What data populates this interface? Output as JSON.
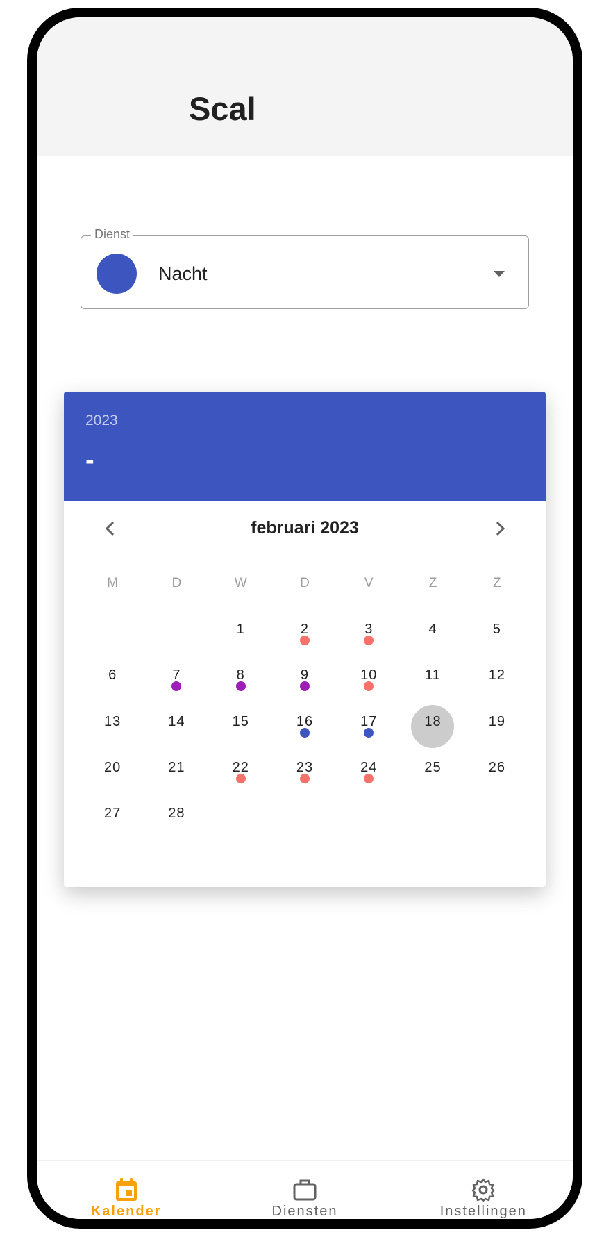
{
  "app": {
    "title": "Scal"
  },
  "dienst": {
    "label": "Dienst",
    "value": "Nacht",
    "color": "#3d55bf"
  },
  "calendar": {
    "header_color": "#3d55bf",
    "year": "2023",
    "selected_label": "-",
    "month_label": "februari 2023",
    "weekdays": [
      "M",
      "D",
      "W",
      "D",
      "V",
      "Z",
      "Z"
    ],
    "colors": {
      "salmon": "#f4726a",
      "purple": "#9c1fb5",
      "blue": "#3d55bf",
      "today": "#cccccc"
    },
    "weeks": [
      [
        null,
        null,
        {
          "d": "1"
        },
        {
          "d": "2",
          "dot": "salmon"
        },
        {
          "d": "3",
          "dot": "salmon"
        },
        {
          "d": "4"
        },
        {
          "d": "5"
        }
      ],
      [
        {
          "d": "6"
        },
        {
          "d": "7",
          "dot": "purple"
        },
        {
          "d": "8",
          "dot": "purple"
        },
        {
          "d": "9",
          "dot": "purple"
        },
        {
          "d": "10",
          "dot": "salmon"
        },
        {
          "d": "11"
        },
        {
          "d": "12"
        }
      ],
      [
        {
          "d": "13"
        },
        {
          "d": "14"
        },
        {
          "d": "15"
        },
        {
          "d": "16",
          "dot": "blue"
        },
        {
          "d": "17",
          "dot": "blue"
        },
        {
          "d": "18",
          "today": true
        },
        {
          "d": "19"
        }
      ],
      [
        {
          "d": "20"
        },
        {
          "d": "21"
        },
        {
          "d": "22",
          "dot": "salmon"
        },
        {
          "d": "23",
          "dot": "salmon"
        },
        {
          "d": "24",
          "dot": "salmon"
        },
        {
          "d": "25"
        },
        {
          "d": "26"
        }
      ],
      [
        {
          "d": "27"
        },
        {
          "d": "28"
        },
        null,
        null,
        null,
        null,
        null
      ]
    ]
  },
  "bottom_nav": {
    "active_color": "#f7a10c",
    "inactive_color": "#616161",
    "items": [
      {
        "label": "Kalender",
        "icon": "calendar-icon",
        "active": true
      },
      {
        "label": "Diensten",
        "icon": "briefcase-icon",
        "active": false
      },
      {
        "label": "Instellingen",
        "icon": "gear-icon",
        "active": false
      }
    ]
  }
}
